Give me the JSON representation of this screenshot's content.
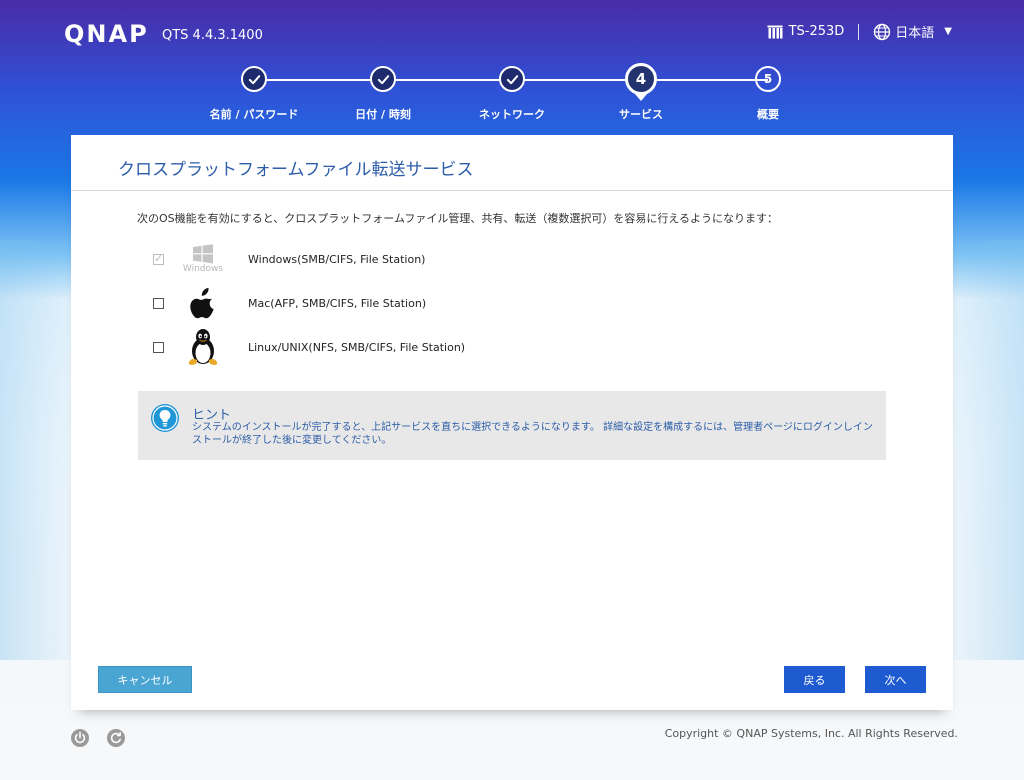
{
  "header": {
    "logo": "QNAP",
    "version": "QTS 4.4.3.1400",
    "device": "TS-253D",
    "language": "日本語"
  },
  "steps": [
    {
      "label": "名前 / パスワード",
      "status": "done"
    },
    {
      "label": "日付 / 時刻",
      "status": "done"
    },
    {
      "label": "ネットワーク",
      "status": "done"
    },
    {
      "number": "4",
      "label": "サービス",
      "status": "current"
    },
    {
      "number": "5",
      "label": "概要",
      "status": "todo"
    }
  ],
  "panel": {
    "title": "クロスプラットフォームファイル転送サービス",
    "intro": "次のOS機能を有効にすると、クロスプラットフォームファイル管理、共有、転送（複数選択可）を容易に行えるようになります：",
    "options": [
      {
        "label": "Windows(SMB/CIFS, File Station)",
        "icon": "windows-icon",
        "icon_caption": "Windows",
        "checked": true,
        "disabled": true
      },
      {
        "label": "Mac(AFP, SMB/CIFS, File Station)",
        "icon": "apple-icon",
        "checked": false,
        "disabled": false
      },
      {
        "label": "Linux/UNIX(NFS, SMB/CIFS, File Station)",
        "icon": "linux-tux-icon",
        "checked": false,
        "disabled": false
      }
    ],
    "hint": {
      "title": "ヒント",
      "text": "システムのインストールが完了すると、上記サービスを直ちに選択できるようになります。 詳細な設定を構成するには、管理者ページにログインしインストールが終了した後に変更してください。"
    }
  },
  "buttons": {
    "cancel": "キャンセル",
    "back": "戻る",
    "next": "次へ"
  },
  "footer": {
    "copyright": "Copyright © QNAP Systems, Inc. All Rights Reserved."
  },
  "colors": {
    "accent": "#2c5da8",
    "primary_button": "#1f5bd0",
    "cancel_button": "#4aa5d3"
  }
}
